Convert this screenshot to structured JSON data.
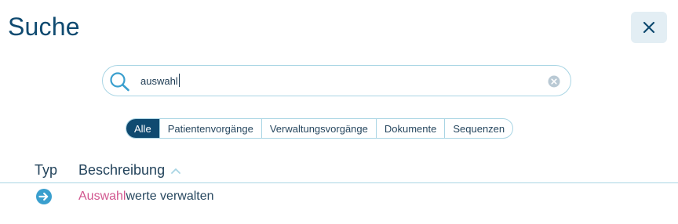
{
  "page": {
    "title": "Suche"
  },
  "search": {
    "value": "auswahl"
  },
  "filters": [
    "Alle",
    "Patientenvorgänge",
    "Verwaltungsvorgänge",
    "Dokumente",
    "Sequenzen"
  ],
  "active_filter": "Alle",
  "table": {
    "headers": {
      "type": "Typ",
      "description": "Beschreibung"
    },
    "sort": "ascending",
    "rows": [
      {
        "icon": "arrow-right-circle-icon",
        "highlight": "Auswahl",
        "rest": "werte verwalten"
      }
    ]
  },
  "colors": {
    "primary": "#0f4a70",
    "border": "#a9d5e4",
    "icon": "#3a9fce",
    "highlight": "#d1578f",
    "close_bg": "#e3eef4"
  }
}
